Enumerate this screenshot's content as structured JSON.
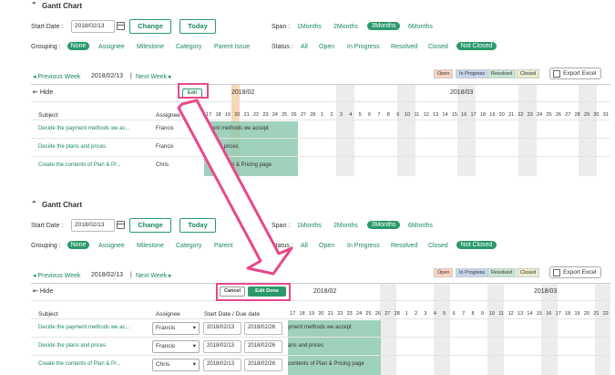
{
  "top": {
    "title": "Gantt Chart",
    "start_date_label": "Start Date :",
    "start_date": "2018/02/13",
    "change_label": "Change",
    "today_label": "Today",
    "span_label": "Span :",
    "span_options": [
      "1Months",
      "2Months",
      "3Months",
      "6Months"
    ],
    "grouping_label": "Grouping :",
    "grouping_options": [
      "None",
      "Assignee",
      "Milestone",
      "Category",
      "Parent Issue"
    ],
    "status_label": "Status :",
    "status_options": [
      "All",
      "Open",
      "In Progress",
      "Resolved",
      "Closed",
      "Not Closed"
    ],
    "prev_week": "Previous Week",
    "current_date": "2018/02/13",
    "next_week": "Next Week",
    "legend": [
      "Open",
      "In Progress",
      "Resolved",
      "Closed"
    ],
    "export_label": "Export Excel",
    "hide_label": "Hide",
    "edit_label": "Edit",
    "month1": "2018/02",
    "month2": "2018/03",
    "col_subject": "Subject",
    "col_assignee": "Assignee",
    "days": [
      "17",
      "18",
      "19",
      "20",
      "21",
      "22",
      "23",
      "24",
      "25",
      "26",
      "27",
      "28",
      "1",
      "2",
      "3",
      "4",
      "5",
      "6",
      "7",
      "8",
      "9",
      "10",
      "11",
      "12",
      "13",
      "14",
      "15",
      "16",
      "17",
      "18",
      "19",
      "20",
      "21",
      "22",
      "23",
      "24",
      "25",
      "26",
      "27",
      "28",
      "29",
      "30",
      "31"
    ],
    "rows": [
      {
        "subject": "Decide the payment methods we ac...",
        "assignee": "Francis",
        "bar_text": "ment methods we accept"
      },
      {
        "subject": "Decide the plans and prices",
        "assignee": "Francis",
        "bar_text": "and prices"
      },
      {
        "subject": "Create the contents of Plan & Pr...",
        "assignee": "Chris",
        "bar_text": "s of Plan & Pricing page"
      }
    ]
  },
  "bottom": {
    "title": "Gantt Chart",
    "start_date_label": "Start Date :",
    "start_date": "2018/02/13",
    "change_label": "Change",
    "today_label": "Today",
    "span_label": "Span :",
    "span_options": [
      "1Months",
      "2Months",
      "3Months",
      "6Months"
    ],
    "grouping_label": "Grouping :",
    "grouping_options": [
      "None",
      "Assignee",
      "Milestone",
      "Category",
      "Parent"
    ],
    "status_label": "Status :",
    "status_options": [
      "All",
      "Open",
      "In Progress",
      "Resolved",
      "Closed",
      "Not Closed"
    ],
    "prev_week": "Previous Week",
    "current_date": "2018/02/13",
    "next_week": "Next Week",
    "legend": [
      "Open",
      "In Progress",
      "Resolved",
      "Closed"
    ],
    "export_label": "Export Excel",
    "hide_label": "Hide",
    "cancel_label": "Cancel",
    "edit_done_label": "Edit Done",
    "month1": "2018/02",
    "month2": "2018/03",
    "col_subject": "Subject",
    "col_assignee": "Assignee",
    "col_dates": "Start Date / Due date",
    "days": [
      "17",
      "18",
      "19",
      "20",
      "21",
      "22",
      "23",
      "24",
      "25",
      "26",
      "27",
      "28",
      "1",
      "2",
      "3",
      "4",
      "5",
      "6",
      "7",
      "8",
      "9",
      "10",
      "11",
      "12",
      "13",
      "14",
      "15",
      "16",
      "17",
      "18",
      "19",
      "20",
      "21",
      "22"
    ],
    "rows": [
      {
        "subject": "Decide the payment methods we ac...",
        "assignee": "Francis",
        "start": "2018/02/13",
        "due": "2018/02/26",
        "bar_text": "yment methods we accept"
      },
      {
        "subject": "Decide the plans and prices",
        "assignee": "Francis",
        "start": "2018/02/13",
        "due": "2018/02/26",
        "bar_text": "ans and prices"
      },
      {
        "subject": "Create the contents of Plan & Pr...",
        "assignee": "Chris",
        "start": "2018/02/13",
        "due": "2018/02/26",
        "bar_text": "contents of Plan & Pricing page"
      }
    ]
  },
  "colors": {
    "accent": "#2a9a6a",
    "highlight": "#e8488a",
    "bar": "#8ec9b0"
  }
}
